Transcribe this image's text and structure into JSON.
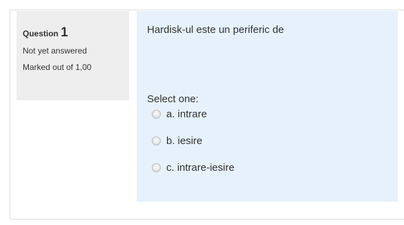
{
  "question": {
    "label": "Question",
    "number": "1",
    "status": "Not yet answered",
    "marks": "Marked out of 1,00",
    "text": "Hardisk-ul este un periferic de",
    "prompt": "Select one:",
    "options": [
      {
        "label": "a. intrare",
        "selected": false
      },
      {
        "label": "b. iesire",
        "selected": false
      },
      {
        "label": "c. intrare-iesire",
        "selected": false
      }
    ]
  },
  "colors": {
    "info_bg": "#eeeeee",
    "content_bg": "#e6f1fb",
    "text": "#333333"
  }
}
